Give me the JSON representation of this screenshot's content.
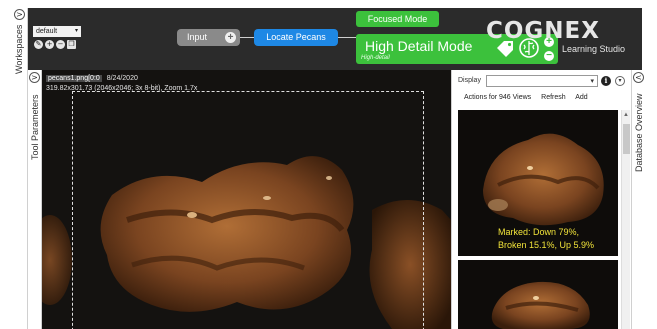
{
  "left_rail": {
    "workspaces_label": "Workspaces",
    "tool_params_label": "Tool Parameters",
    "toggle_glyph": ">"
  },
  "workspace": {
    "selected": "default",
    "caret": "▾",
    "icons": [
      "pin-icon",
      "add-icon",
      "remove-icon",
      "copy-icon"
    ]
  },
  "pipeline": {
    "input_label": "Input",
    "input_plus": "+",
    "locate_label": "Locate Pecans",
    "focused_mode_label": "Focused Mode",
    "tool_title": "High Detail Mode",
    "tool_subtitle": "High-detail",
    "plus": "+",
    "minus": "−"
  },
  "brand": {
    "logo_text": "COGNEX",
    "subtitle": "Learning Studio"
  },
  "viewer": {
    "filename": "pecans1.png[0:0",
    "date": "8/24/2020",
    "details": "319.82x301.73 (2046x2046; 3x 8-bit), Zoom 1.7x"
  },
  "database": {
    "display_label": "Display",
    "select_caret": "▾",
    "info_glyph": "i",
    "chevron_glyph": "▾",
    "actions_label": "Actions for 946 Views",
    "refresh_label": "Refresh",
    "add_label": "Add",
    "caption_line1": "Marked: Down 79%,",
    "caption_line2": "Broken 15.1%, Up 5.9%",
    "scroll_up_glyph": "▲"
  },
  "right_rail": {
    "label": "Database Overview",
    "toggle_glyph": "<"
  },
  "colors": {
    "accent_green": "#3cc13c",
    "accent_blue": "#1e88e5",
    "caption_yellow": "#f2e43a",
    "topbar": "#2b2b2b"
  }
}
